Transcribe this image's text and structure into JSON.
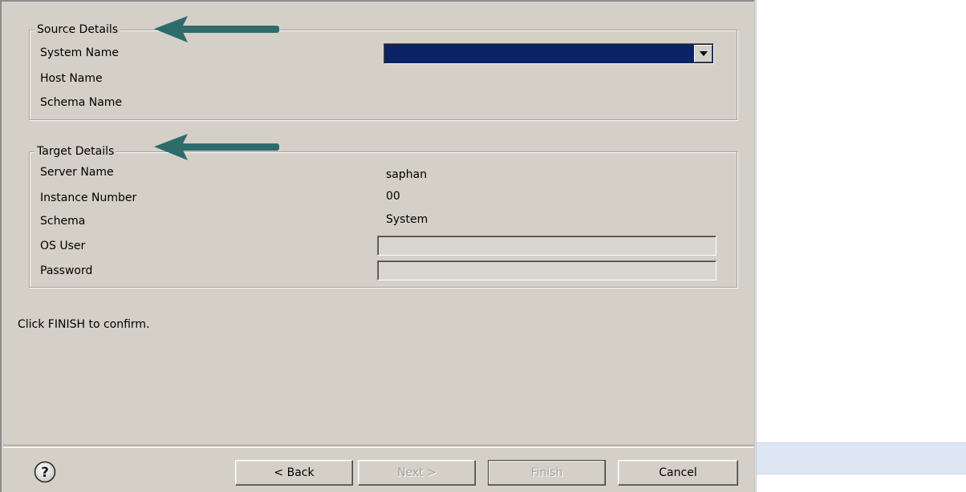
{
  "source_details": {
    "title": "Source Details",
    "labels": {
      "system_name": "System Name",
      "host_name": "Host Name",
      "schema_name": "Schema Name"
    },
    "system_name_value": ""
  },
  "target_details": {
    "title": "Target Details",
    "labels": {
      "server_name": "Server Name",
      "instance_number": "Instance Number",
      "schema": "Schema",
      "os_user": "OS User",
      "password": "Password"
    },
    "values": {
      "server_name": "saphan",
      "instance_number": "00",
      "schema": "System",
      "os_user": "",
      "password": ""
    }
  },
  "message": "Click FINISH to confirm.",
  "buttons": {
    "back": "< Back",
    "next": "Next >",
    "finish": "Finish",
    "cancel": "Cancel"
  },
  "icons": {
    "help": "help-icon",
    "dropdown": "chevron-down-icon",
    "annotation_arrow": "arrow-left-icon"
  },
  "colors": {
    "dialog_bg": "#d4d0c8",
    "combo_selected": "#0b2466",
    "annotation_arrow": "#2e6b6b",
    "disabled_text": "#a0a0a0"
  }
}
